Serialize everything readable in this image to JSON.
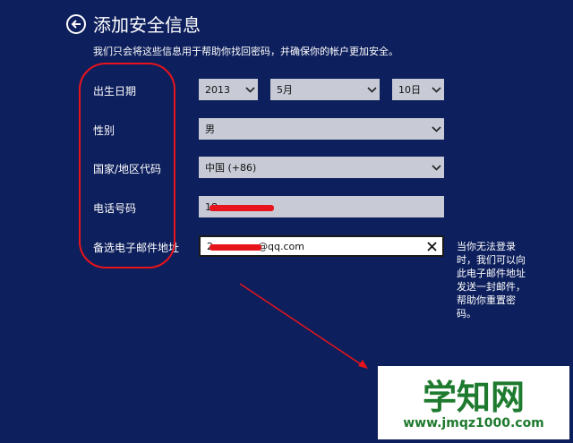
{
  "header": {
    "title": "添加安全信息",
    "subtitle": "我们只会将这些信息用于帮助你找回密码，并确保你的帐户更加安全。"
  },
  "form": {
    "birthday_label": "出生日期",
    "birth_year": "2013",
    "birth_month": "5月",
    "birth_day": "10日",
    "gender_label": "性别",
    "gender_value": "男",
    "country_label": "国家/地区代码",
    "country_value": "中国 (+86)",
    "phone_label": "电话号码",
    "phone_value": "18",
    "email_label": "备选电子邮件地址",
    "email_value": "2",
    "email_suffix": "@qq.com"
  },
  "help_text": "当你无法登录时，我们可以向此电子邮件地址发送一封邮件，帮助你重置密码。",
  "annotation": {
    "color": "#e8141c"
  },
  "watermark": {
    "main": "学知网",
    "url": "www.jmqz1000.com"
  },
  "icons": {
    "back": "back-arrow-icon",
    "dropdown": "chevron-down-icon",
    "clear": "close-icon"
  },
  "colors": {
    "background": "#0d1f5c",
    "field": "#c8cbd6",
    "accent": "#e8141c"
  }
}
